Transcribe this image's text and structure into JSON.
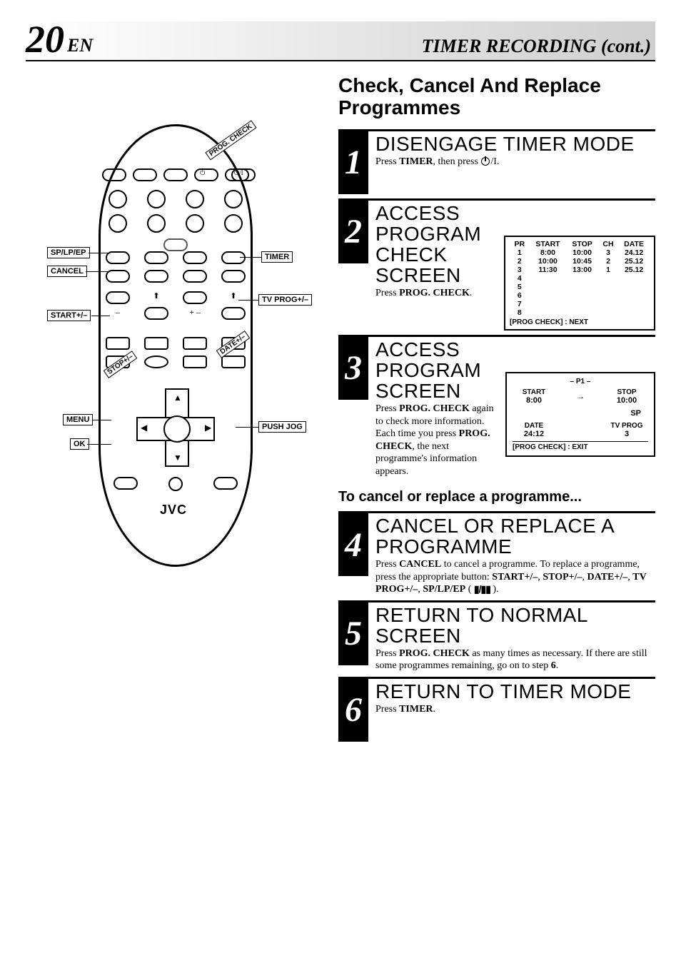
{
  "header": {
    "page_number": "20",
    "lang": "EN",
    "title": "TIMER RECORDING (cont.)"
  },
  "main_title": "Check, Cancel And Replace Programmes",
  "remote": {
    "brand": "JVC",
    "labels": {
      "prog_check": "PROG. CHECK",
      "sp_lp_ep": "SP/LP/EP",
      "cancel": "CANCEL",
      "timer": "TIMER",
      "start": "START+/–",
      "tv_prog": "TV PROG+/–",
      "stop": "STOP+/–",
      "date": "DATE+/–",
      "menu": "MENU",
      "ok": "OK",
      "push_jog": "PUSH JOG"
    }
  },
  "steps": [
    {
      "n": "1",
      "title": "DISENGAGE TIMER MODE",
      "body_parts": [
        "Press ",
        "TIMER",
        ", then press ",
        "POWER_ICON",
        "/I."
      ]
    },
    {
      "n": "2",
      "title": "ACCESS PROGRAM CHECK SCREEN",
      "body_parts": [
        "Press ",
        "PROG. CHECK",
        "."
      ]
    },
    {
      "n": "3",
      "title": "ACCESS PROGRAM SCREEN",
      "body_parts": [
        "Press ",
        "PROG. CHECK",
        " again to check more information. Each time you press ",
        "PROG. CHECK",
        ", the next programme's information appears."
      ]
    }
  ],
  "osd_table": {
    "headers": [
      "PR",
      "START",
      "STOP",
      "CH",
      "DATE"
    ],
    "rows": [
      [
        "1",
        "8:00",
        "10:00",
        "3",
        "24.12"
      ],
      [
        "2",
        "10:00",
        "10:45",
        "2",
        "25.12"
      ],
      [
        "3",
        "11:30",
        "13:00",
        "1",
        "25.12"
      ],
      [
        "4",
        "",
        "",
        "",
        ""
      ],
      [
        "5",
        "",
        "",
        "",
        ""
      ],
      [
        "6",
        "",
        "",
        "",
        ""
      ],
      [
        "7",
        "",
        "",
        "",
        ""
      ],
      [
        "8",
        "",
        "",
        "",
        ""
      ]
    ],
    "footer": "[PROG CHECK] : NEXT"
  },
  "osd_detail": {
    "header": "– P1 –",
    "start_lbl": "START",
    "start_val": "8:00",
    "stop_lbl": "STOP",
    "stop_val": "10:00",
    "speed": "SP",
    "date_lbl": "DATE",
    "date_val": "24:12",
    "tv_lbl": "TV PROG",
    "tv_val": "3",
    "footer": "[PROG CHECK] : EXIT"
  },
  "sub_title": "To cancel or replace a programme...",
  "steps2": [
    {
      "n": "4",
      "title": "CANCEL OR REPLACE A PROGRAMME",
      "body_html": "Press <b>CANCEL</b> to cancel a programme. To replace a programme, press the appropriate button: <b>START+/–</b>, <b>STOP+/–</b>, <b>DATE+/–</b>, <b>TV PROG+/–</b>, <b>SP/LP/EP</b> ( <span class='bars-icon'>▮/▮▮</span> )."
    },
    {
      "n": "5",
      "title": "RETURN TO NORMAL SCREEN",
      "body_html": "Press <b>PROG. CHECK</b> as many times as necessary. If there are still some programmes remaining, go on to step <b>6</b>."
    },
    {
      "n": "6",
      "title": "RETURN TO TIMER MODE",
      "body_html": "Press <b>TIMER</b>."
    }
  ]
}
